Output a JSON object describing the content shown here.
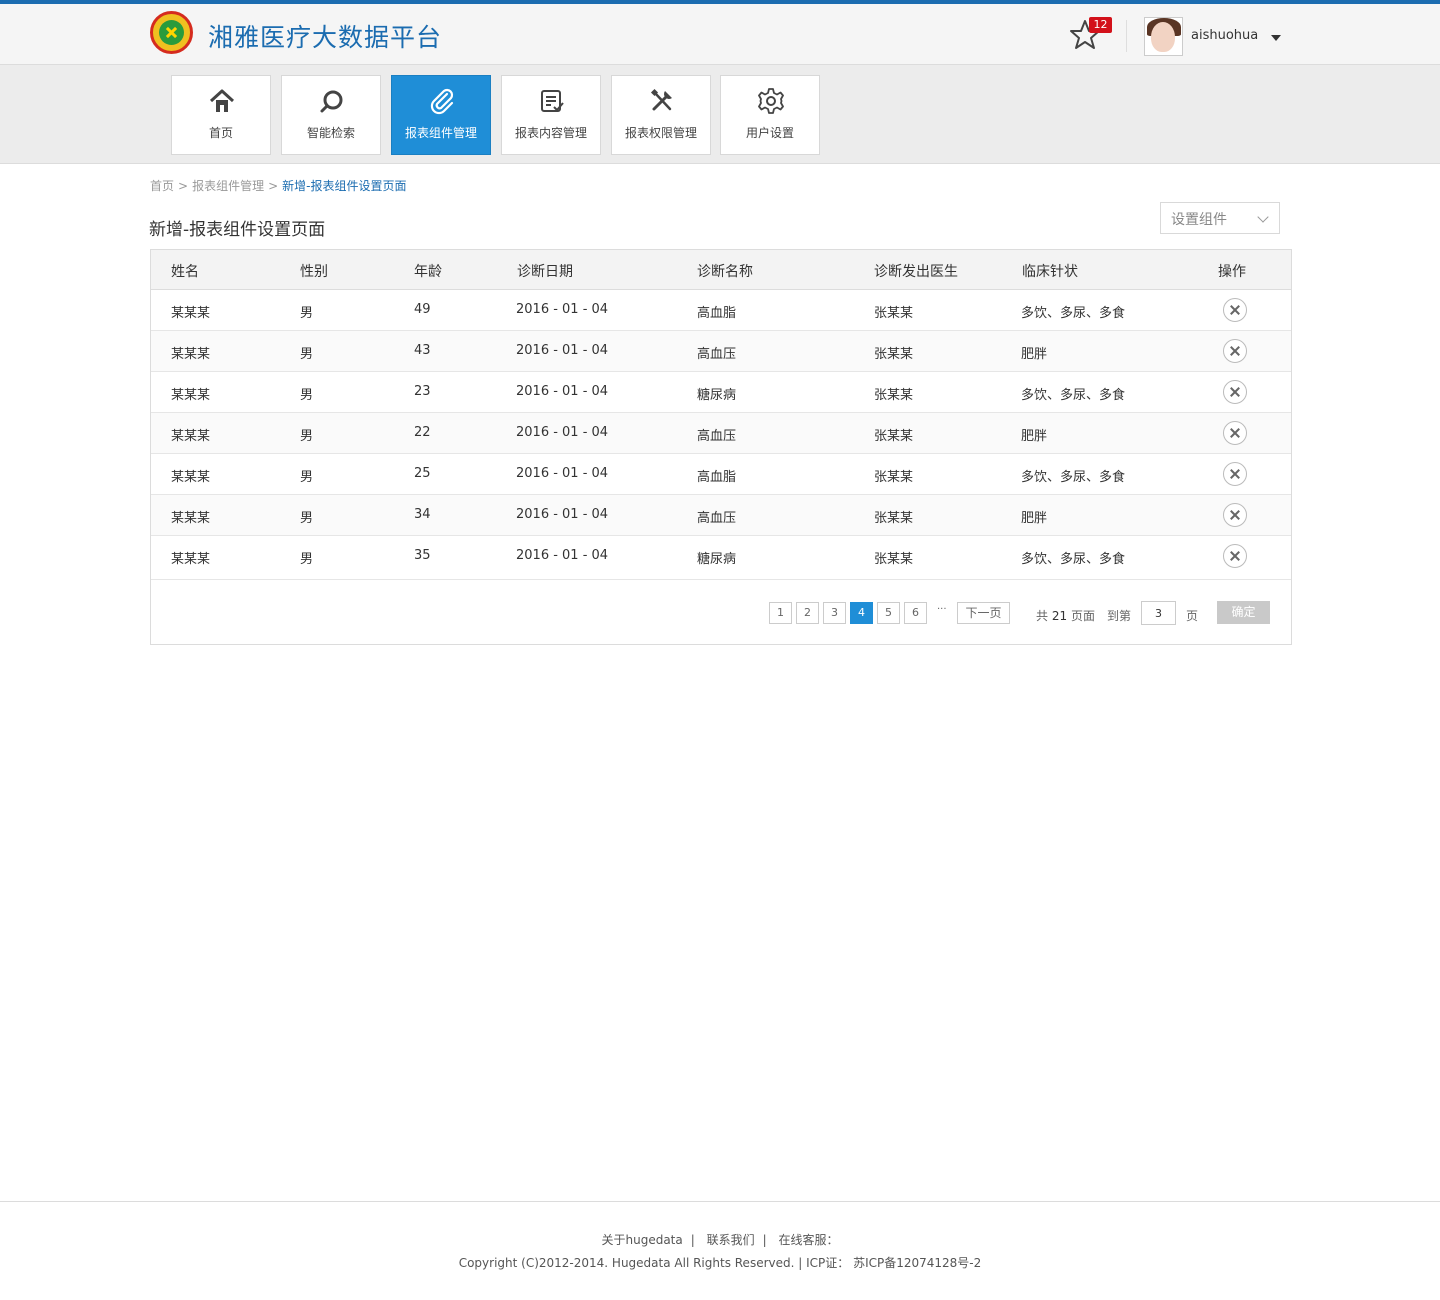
{
  "header": {
    "app_title": "湘雅医疗大数据平台",
    "favorites_count": "12",
    "username": "aishuohua"
  },
  "nav": {
    "items": [
      {
        "label": "首页",
        "icon": "home-icon"
      },
      {
        "label": "智能检索",
        "icon": "search-icon"
      },
      {
        "label": "报表组件管理",
        "icon": "paperclip-icon",
        "active": true
      },
      {
        "label": "报表内容管理",
        "icon": "report-list-icon"
      },
      {
        "label": "报表权限管理",
        "icon": "tools-icon"
      },
      {
        "label": "用户设置",
        "icon": "gear-icon"
      }
    ]
  },
  "breadcrumb": {
    "items": [
      "首页",
      "报表组件管理",
      "新增-报表组件设置页面"
    ],
    "separator": ">"
  },
  "page": {
    "title": "新增-报表组件设置页面",
    "component_select": "设置组件"
  },
  "table": {
    "columns": [
      "姓名",
      "性别",
      "年龄",
      "诊断日期",
      "诊断名称",
      "诊断发出医生",
      "临床针状",
      "操作"
    ],
    "rows": [
      [
        "某某某",
        "男",
        "49",
        "2016 - 01 - 04",
        "高血脂",
        "张某某",
        "多饮、多尿、多食"
      ],
      [
        "某某某",
        "男",
        "43",
        "2016 - 01 - 04",
        "高血压",
        "张某某",
        "肥胖"
      ],
      [
        "某某某",
        "男",
        "23",
        "2016 - 01 - 04",
        "糖尿病",
        "张某某",
        "多饮、多尿、多食"
      ],
      [
        "某某某",
        "男",
        "22",
        "2016 - 01 - 04",
        "高血压",
        "张某某",
        "肥胖"
      ],
      [
        "某某某",
        "男",
        "25",
        "2016 - 01 - 04",
        "高血脂",
        "张某某",
        "多饮、多尿、多食"
      ],
      [
        "某某某",
        "男",
        "34",
        "2016 - 01 - 04",
        "高血压",
        "张某某",
        "肥胖"
      ],
      [
        "某某某",
        "男",
        "35",
        "2016 - 01 - 04",
        "糖尿病",
        "张某某",
        "多饮、多尿、多食"
      ]
    ]
  },
  "pagination": {
    "pages": [
      "1",
      "2",
      "3",
      "4",
      "5",
      "6"
    ],
    "current": "4",
    "ellipsis": "···",
    "next": "下一页",
    "total_prefix": "共",
    "total": "21",
    "total_suffix": "页面",
    "goto_prefix": "到第",
    "goto_value": "3",
    "goto_suffix": "页",
    "confirm": "确定"
  },
  "footer": {
    "about": "关于hugedata",
    "contact": "联系我们",
    "service": "在线客服：",
    "divider": "|",
    "copyright": "Copyright (C)2012-2014. Hugedata All Rights Reserved. | ICP证： 苏ICP备12074128号-2"
  },
  "colors": {
    "brand_blue": "#1b6cb0",
    "active_tile": "#1f8ed7",
    "badge_red": "#d3111a",
    "confirm_gray": "#c9c9c9"
  }
}
